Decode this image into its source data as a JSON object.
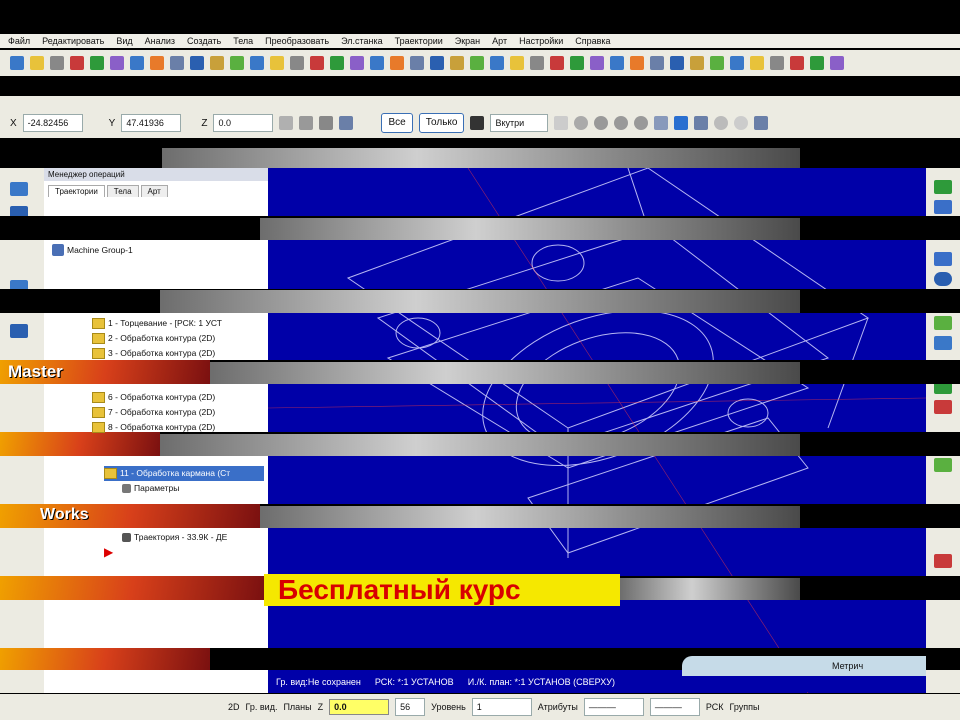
{
  "menu": [
    "Файл",
    "Редактировать",
    "Вид",
    "Анализ",
    "Создать",
    "Тела",
    "Преобразовать",
    "Эл.станка",
    "Траектории",
    "Экран",
    "Арт",
    "Настройки",
    "Справка"
  ],
  "coords": {
    "x_label": "X",
    "x_value": "-24.82456",
    "y_label": "Y",
    "y_value": "47.41936",
    "z_label": "Z",
    "z_value": "0.0"
  },
  "toolbar_buttons": {
    "all": "Все",
    "alone": "Только",
    "view_select": "Вкутри"
  },
  "panel": {
    "title": "Менеджер операций",
    "tabs": [
      "Траектории",
      "Тела",
      "Арт"
    ],
    "machine_group": "Machine Group-1",
    "operations": [
      "1 - Торцевание - [РСК: 1 УСТ",
      "2 - Обработка контура (2D)",
      "3 - Обработка контура (2D)",
      "6 - Обработка контура (2D)",
      "7 - Обработка контура (2D)",
      "8 - Обработка контура (2D)",
      "11 - Обработка кармана (Ст",
      "Параметры",
      "Траектория - 33.9К - ДЕ"
    ]
  },
  "status": {
    "group": "Гр. вид:Не сохранен",
    "wcs": "РСК: *:1 УСТАНОВ",
    "tplane": "И./К. план: *:1 УСТАНОВ (СВЕРХУ)",
    "units": "Метрич"
  },
  "bottom": {
    "mode": "2D",
    "group_view": "Гр. вид.",
    "planes": "Планы",
    "z_label": "Z",
    "z_value": "0.0",
    "num": "56",
    "level_label": "Уровень",
    "level_value": "1",
    "attrs": "Атрибуты",
    "wcs": "РСК",
    "groups": "Группы"
  },
  "promo": {
    "text": "Бесплатный курс",
    "brand1": "Master",
    "brand2": "Works"
  },
  "colors": {
    "viewport": "#0000a8",
    "promo_bg": "#f5e800",
    "promo_text": "#d80000"
  }
}
